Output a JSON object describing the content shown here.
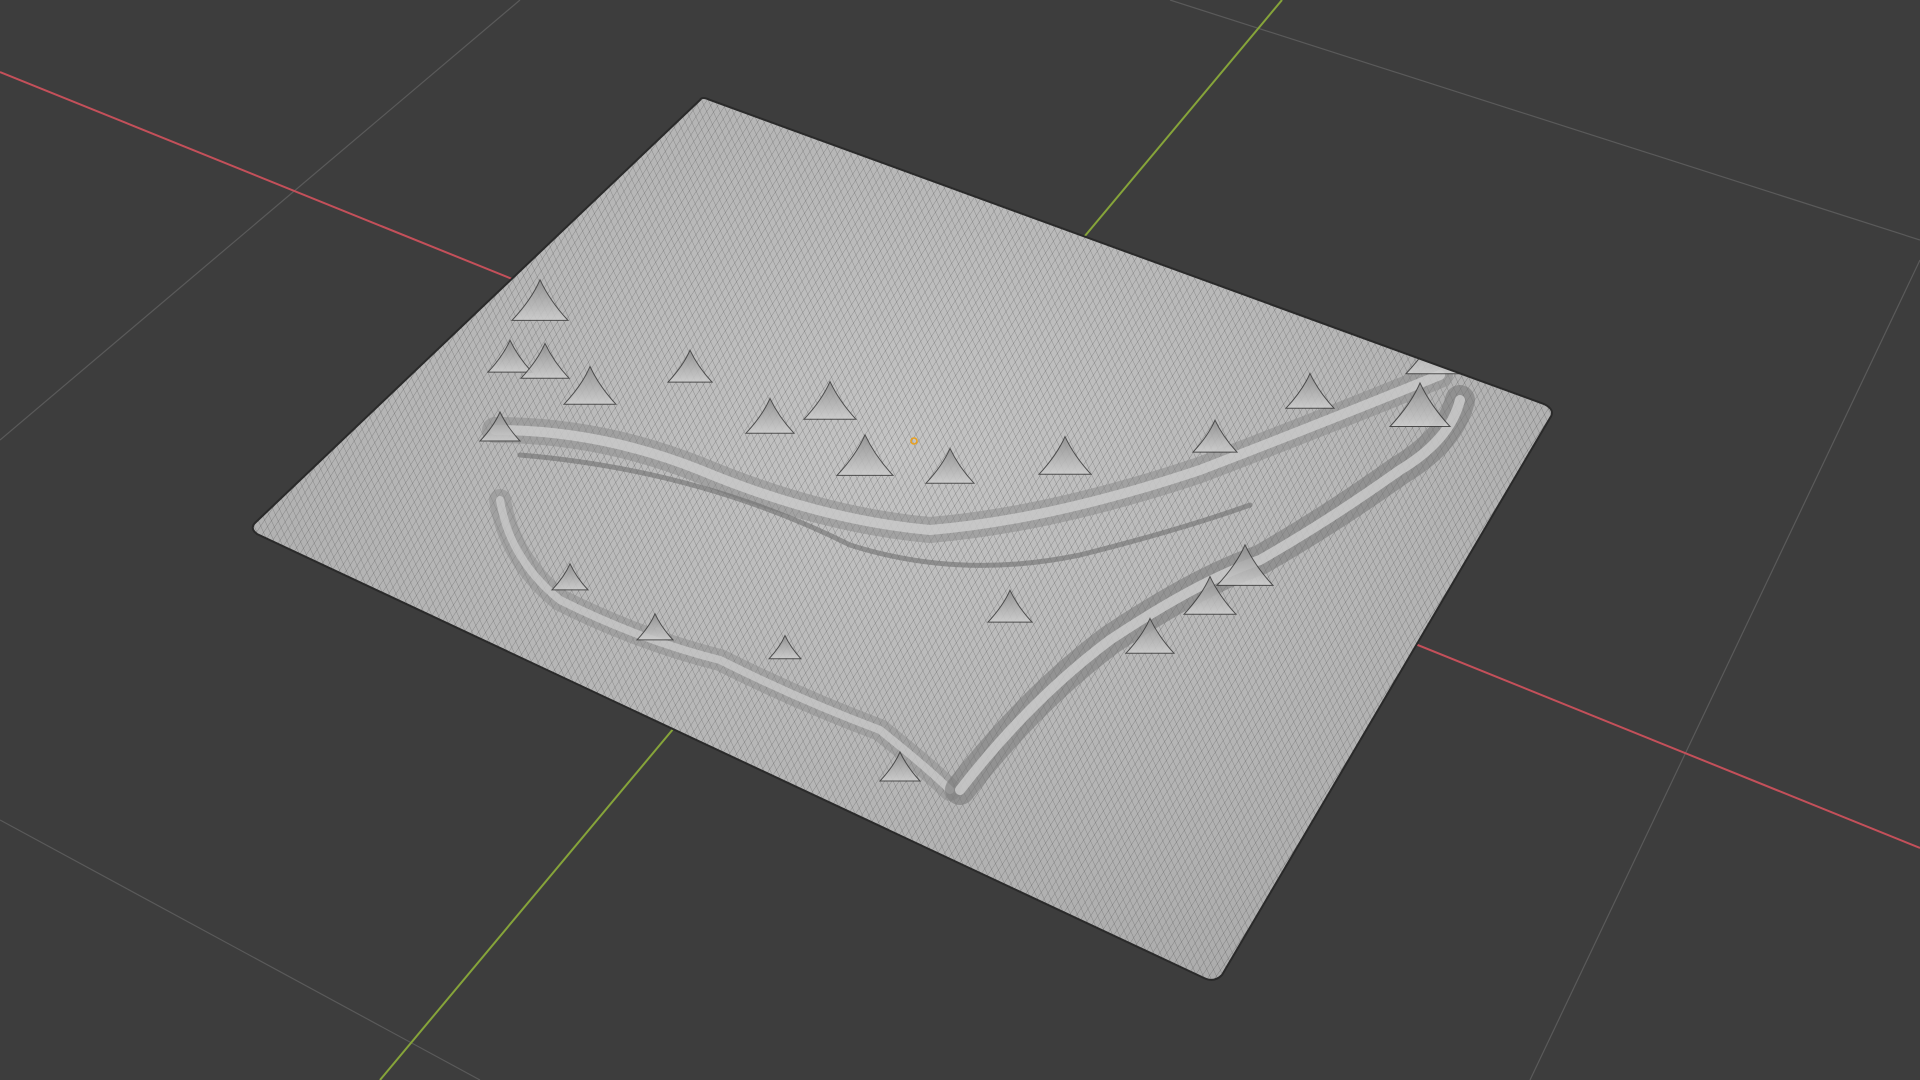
{
  "app": {
    "editor": "3D Viewport"
  },
  "viewport": {
    "background": "#3d3d3d",
    "grid_color": "#5a5a5a",
    "x_axis_color": "#c4505a",
    "y_axis_color": "#86a43a",
    "origin_color": "#e8a020",
    "object": {
      "type": "terrain-mesh",
      "surface_color": "#b9b9b9",
      "wire_color": "#2e2e2e",
      "wire_density": 180
    }
  }
}
